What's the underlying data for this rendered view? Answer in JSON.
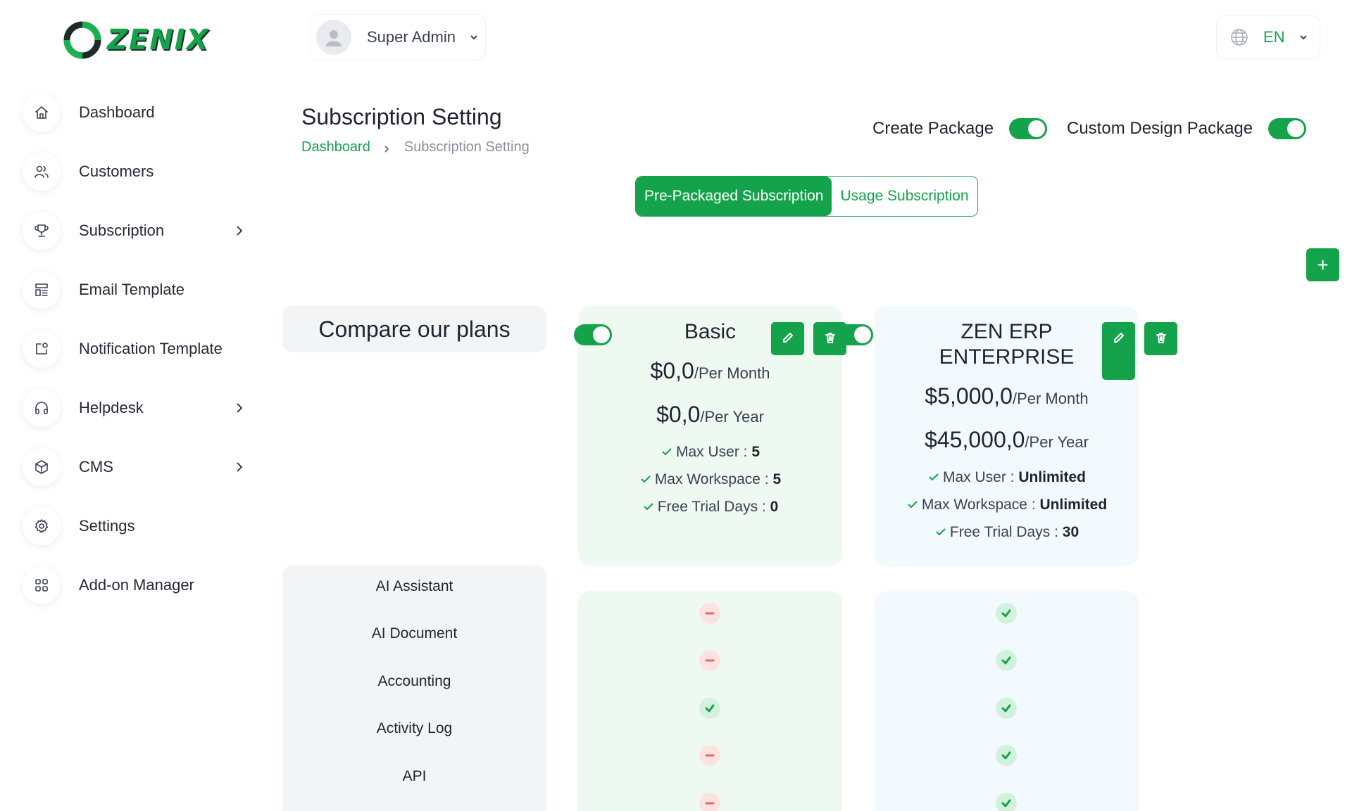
{
  "header": {
    "user_name": "Super Admin",
    "language": "EN"
  },
  "sidebar": {
    "items": [
      {
        "label": "Dashboard",
        "icon": "home-icon",
        "has_submenu": false
      },
      {
        "label": "Customers",
        "icon": "users-icon",
        "has_submenu": false
      },
      {
        "label": "Subscription",
        "icon": "trophy-icon",
        "has_submenu": true
      },
      {
        "label": "Email Template",
        "icon": "template-icon",
        "has_submenu": false
      },
      {
        "label": "Notification Template",
        "icon": "notification-icon",
        "has_submenu": false
      },
      {
        "label": "Helpdesk",
        "icon": "headphones-icon",
        "has_submenu": true
      },
      {
        "label": "CMS",
        "icon": "package-icon",
        "has_submenu": true
      },
      {
        "label": "Settings",
        "icon": "gear-icon",
        "has_submenu": false
      },
      {
        "label": "Add-on Manager",
        "icon": "apps-icon",
        "has_submenu": false
      }
    ]
  },
  "page": {
    "title": "Subscription Setting",
    "breadcrumb": {
      "root": "Dashboard",
      "current": "Subscription Setting"
    },
    "toggles": {
      "create_package": "Create Package",
      "custom_design_package": "Custom Design Package"
    },
    "tabs": {
      "active": "Pre-Packaged Subscription",
      "inactive": "Usage Subscription"
    },
    "add_label": "+",
    "compare_heading": "Compare our plans"
  },
  "plans": [
    {
      "name": "Basic",
      "price_month": "$0,0",
      "price_year": "$0,0",
      "per_month": "/Per Month",
      "per_year": "/Per Year",
      "max_user_label": "Max User :",
      "max_user": "5",
      "max_workspace_label": "Max Workspace :",
      "max_workspace": "5",
      "trial_label": "Free Trial Days :",
      "trial_days": "0",
      "enabled": true
    },
    {
      "name_line1": "ZEN ERP",
      "name_line2": "ENTERPRISE",
      "price_month": "$5,000,0",
      "price_year": "$45,000,0",
      "per_month": "/Per Month",
      "per_year": "/Per Year",
      "max_user_label": "Max User :",
      "max_user": "Unlimited",
      "max_workspace_label": "Max Workspace :",
      "max_workspace": "Unlimited",
      "trial_label": "Free Trial Days :",
      "trial_days": "30",
      "enabled": true
    }
  ],
  "features": [
    "AI Assistant",
    "AI Document",
    "Accounting",
    "Activity Log",
    "API"
  ],
  "colors": {
    "accent": "#14a34a",
    "yes": "#14a34a",
    "no": "#f06464"
  }
}
